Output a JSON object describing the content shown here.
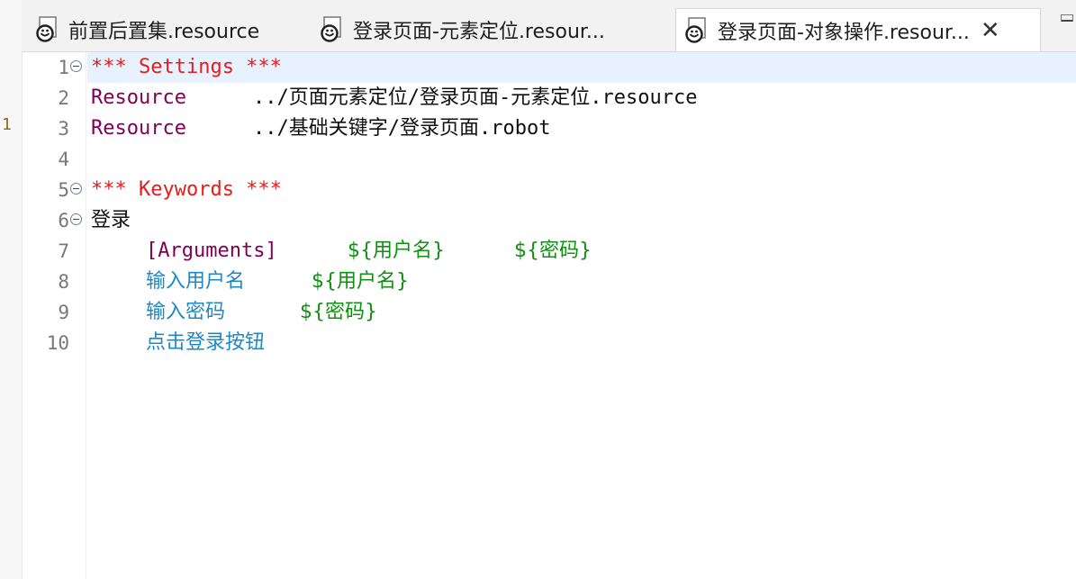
{
  "tabs": [
    {
      "label": "前置后置集.resource",
      "icon": "robot-resource-icon",
      "active": false
    },
    {
      "label": "登录页面-元素定位.resour...",
      "icon": "robot-resource-icon",
      "active": false
    },
    {
      "label": "登录页面-对象操作.resour...",
      "icon": "robot-resource-icon",
      "active": true
    }
  ],
  "tab_close": "✕",
  "left_marker": "1",
  "editor": {
    "line_numbers": [
      "1",
      "2",
      "3",
      "4",
      "5",
      "6",
      "7",
      "8",
      "9",
      "10"
    ],
    "lines": {
      "l1": "*** Settings ***",
      "l2_kw": "Resource",
      "l2_path": "../页面元素定位/登录页面-元素定位.resource",
      "l3_kw": "Resource",
      "l3_path": "../基础关键字/登录页面.robot",
      "l5": "*** Keywords ***",
      "l6": "登录",
      "l7_args": "[Arguments]",
      "l7_v1": "${用户名}",
      "l7_v2": "${密码}",
      "l8_kw": "输入用户名",
      "l8_v": "${用户名}",
      "l9_kw": "输入密码",
      "l9_v": "${密码}",
      "l10_kw": "点击登录按钮"
    }
  },
  "colors": {
    "section": "#e51c1c",
    "setting": "#7f0055",
    "keyword_call": "#1e88c7",
    "variable": "#109010",
    "current_line": "#e8f2fe"
  }
}
